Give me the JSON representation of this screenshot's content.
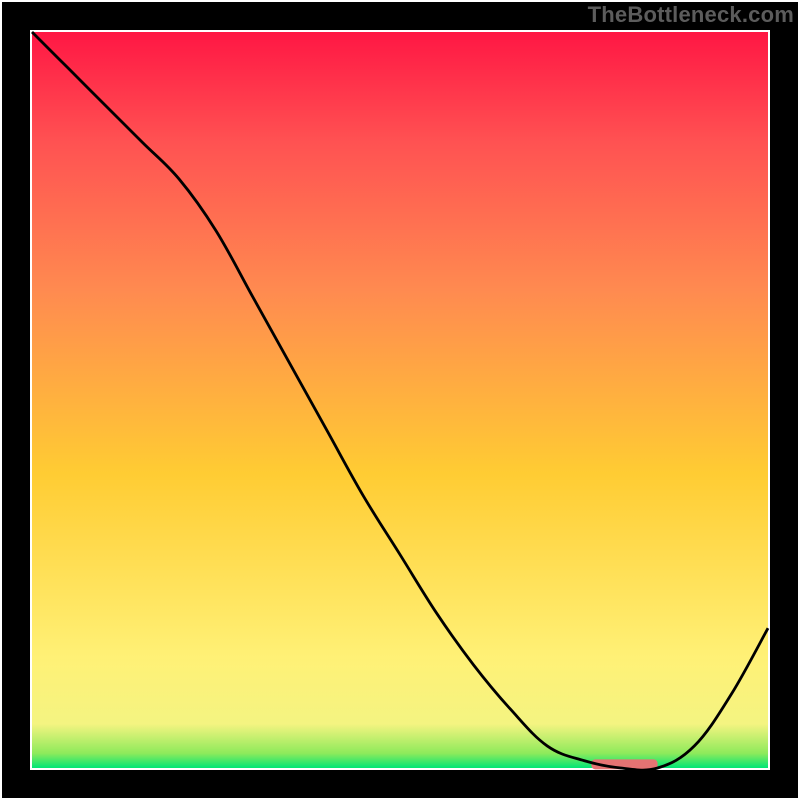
{
  "watermark": "TheBottleneck.com",
  "chart_data": {
    "type": "line",
    "title": "",
    "xlabel": "",
    "ylabel": "",
    "xlim": [
      0,
      100
    ],
    "ylim": [
      0,
      100
    ],
    "x": [
      0,
      5,
      10,
      15,
      20,
      25,
      30,
      35,
      40,
      45,
      50,
      55,
      60,
      65,
      70,
      75,
      80,
      85,
      90,
      95,
      100
    ],
    "values": [
      100,
      95,
      90,
      85,
      80,
      73,
      64,
      55,
      46,
      37,
      29,
      21,
      14,
      8,
      3,
      1,
      0,
      0,
      3,
      10,
      19
    ],
    "marker": {
      "x_start": 76,
      "x_end": 85,
      "y": 0.5,
      "color": "#e57373"
    },
    "gradient_stops": [
      {
        "offset": 0,
        "color": "#00e676"
      },
      {
        "offset": 2,
        "color": "#8eea5b"
      },
      {
        "offset": 6,
        "color": "#f4f481"
      },
      {
        "offset": 15,
        "color": "#fff176"
      },
      {
        "offset": 40,
        "color": "#ffcc33"
      },
      {
        "offset": 65,
        "color": "#ff8a50"
      },
      {
        "offset": 85,
        "color": "#ff5252"
      },
      {
        "offset": 100,
        "color": "#ff1744"
      }
    ],
    "frame_color": "#000000",
    "line_color": "#000000"
  }
}
